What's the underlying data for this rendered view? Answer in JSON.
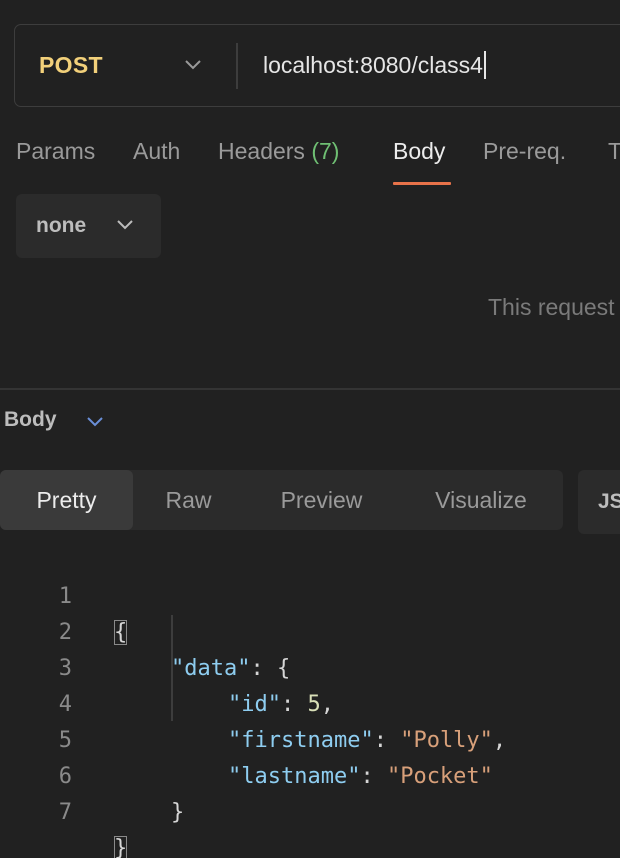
{
  "request": {
    "method": "POST",
    "url": "localhost:8080/class4"
  },
  "request_tabs": {
    "params": "Params",
    "auth": "Auth",
    "headers": "Headers",
    "headers_count": "(7)",
    "body": "Body",
    "prereq": "Pre-req.",
    "tests_partial": "T"
  },
  "body_type": {
    "selected": "none"
  },
  "no_body_message": "This request does not have a body",
  "response": {
    "section_title": "Body",
    "view_tabs": [
      "Pretty",
      "Raw",
      "Preview",
      "Visualize"
    ],
    "active_view": "Pretty",
    "format": "JSON",
    "line_numbers": [
      "1",
      "2",
      "3",
      "4",
      "5",
      "6",
      "7"
    ],
    "json": {
      "data_key": "\"data\"",
      "id_key": "\"id\"",
      "id_value": "5",
      "firstname_key": "\"firstname\"",
      "firstname_value": "\"Polly\"",
      "lastname_key": "\"lastname\"",
      "lastname_value": "\"Pocket\""
    }
  },
  "colors": {
    "method": "#f2d07a",
    "active_tab_underline": "#e8734a",
    "headers_count": "#6fbf73",
    "json_key": "#8ecdf0",
    "json_string": "#d8a07a",
    "json_number": "#d9e0b8"
  }
}
